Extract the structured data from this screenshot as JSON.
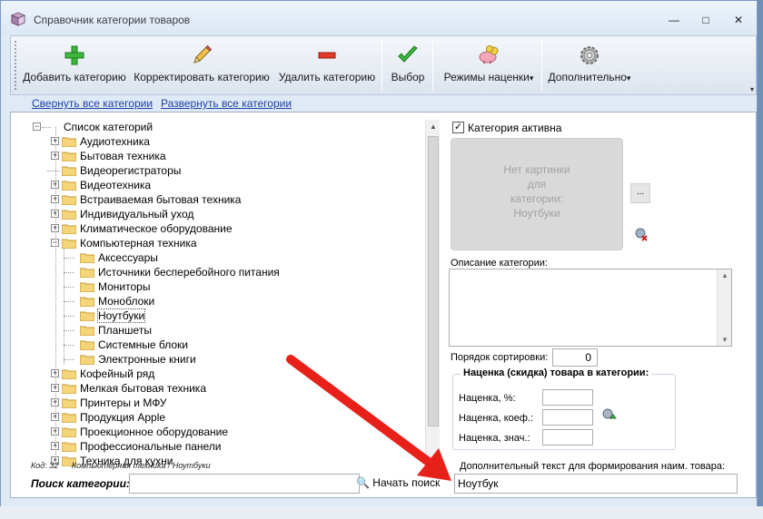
{
  "window": {
    "title": "Справочник категории товаров",
    "controls": {
      "minimize": "—",
      "maximize": "□",
      "close": "✕"
    }
  },
  "toolbar": {
    "add": "Добавить категорию",
    "edit": "Корректировать категорию",
    "delete": "Удалить категорию",
    "select": "Выбор",
    "markup_modes": "Режимы наценки",
    "extra": "Дополнительно",
    "dropdown_glyph": "▾",
    "icons": [
      "add-plus-icon",
      "edit-pencil-icon",
      "delete-minus-icon",
      "select-check-icon",
      "piggy-bank-icon",
      "gear-icon"
    ]
  },
  "links": {
    "collapse": "Свернуть все категории",
    "expand": "Развернуть все категории"
  },
  "tree": {
    "root": "Список категорий",
    "items": [
      {
        "label": "Аудиотехника",
        "expander": "+"
      },
      {
        "label": "Бытовая техника",
        "expander": "+"
      },
      {
        "label": "Видеорегистраторы",
        "expander": ""
      },
      {
        "label": "Видеотехника",
        "expander": "+"
      },
      {
        "label": "Встраиваемая бытовая техника",
        "expander": "+"
      },
      {
        "label": "Индивидуальный уход",
        "expander": "+"
      },
      {
        "label": "Климатическое оборудование",
        "expander": "+"
      },
      {
        "label": "Компьютерная техника",
        "expander": "−"
      },
      {
        "label": "Аксессуары",
        "child": true
      },
      {
        "label": "Источники бесперебойного питания",
        "child": true
      },
      {
        "label": "Мониторы",
        "child": true
      },
      {
        "label": "Моноблоки",
        "child": true
      },
      {
        "label": "Ноутбуки",
        "child": true,
        "selected": true
      },
      {
        "label": "Планшеты",
        "child": true
      },
      {
        "label": "Системные блоки",
        "child": true
      },
      {
        "label": "Электронные книги",
        "child": true
      },
      {
        "label": "Кофейный ряд",
        "expander": "+"
      },
      {
        "label": "Мелкая бытовая техника",
        "expander": "+"
      },
      {
        "label": "Принтеры и МФУ",
        "expander": "+"
      },
      {
        "label": "Продукция Apple",
        "expander": "+"
      },
      {
        "label": "Проекционное оборудование",
        "expander": "+"
      },
      {
        "label": "Профессиональные панели",
        "expander": "+"
      },
      {
        "label": "Техника для кухни",
        "expander": "+"
      }
    ]
  },
  "status": {
    "code": "Код: 32",
    "path": "Компьютерная техника / Ноутбуки"
  },
  "search": {
    "label": "Поиск категории:",
    "value": "",
    "button": "Начать поиск"
  },
  "details": {
    "active_label": "Категория активна",
    "active_checked": "✓",
    "no_image": [
      "Нет картинки",
      "для",
      "категории:",
      "Ноутбуки"
    ],
    "browse_button": "...",
    "description_label": "Описание категории:",
    "description_value": "",
    "sort_label": "Порядок сортировки:",
    "sort_value": "0",
    "markup_group_title": "Наценка (скидка) товара в категории:",
    "markup_percent_label": "Наценка, %:",
    "markup_coef_label": "Наценка, коеф.:",
    "markup_value_label": "Наценка, знач.:",
    "extra_text_label": "Дополнительный текст для формирования наим. товара:",
    "extra_text_value": "Ноутбук"
  },
  "colors": {
    "arrow": "#e8201a",
    "link": "#1f3fa8",
    "window_bg": "#dfeaf6"
  }
}
